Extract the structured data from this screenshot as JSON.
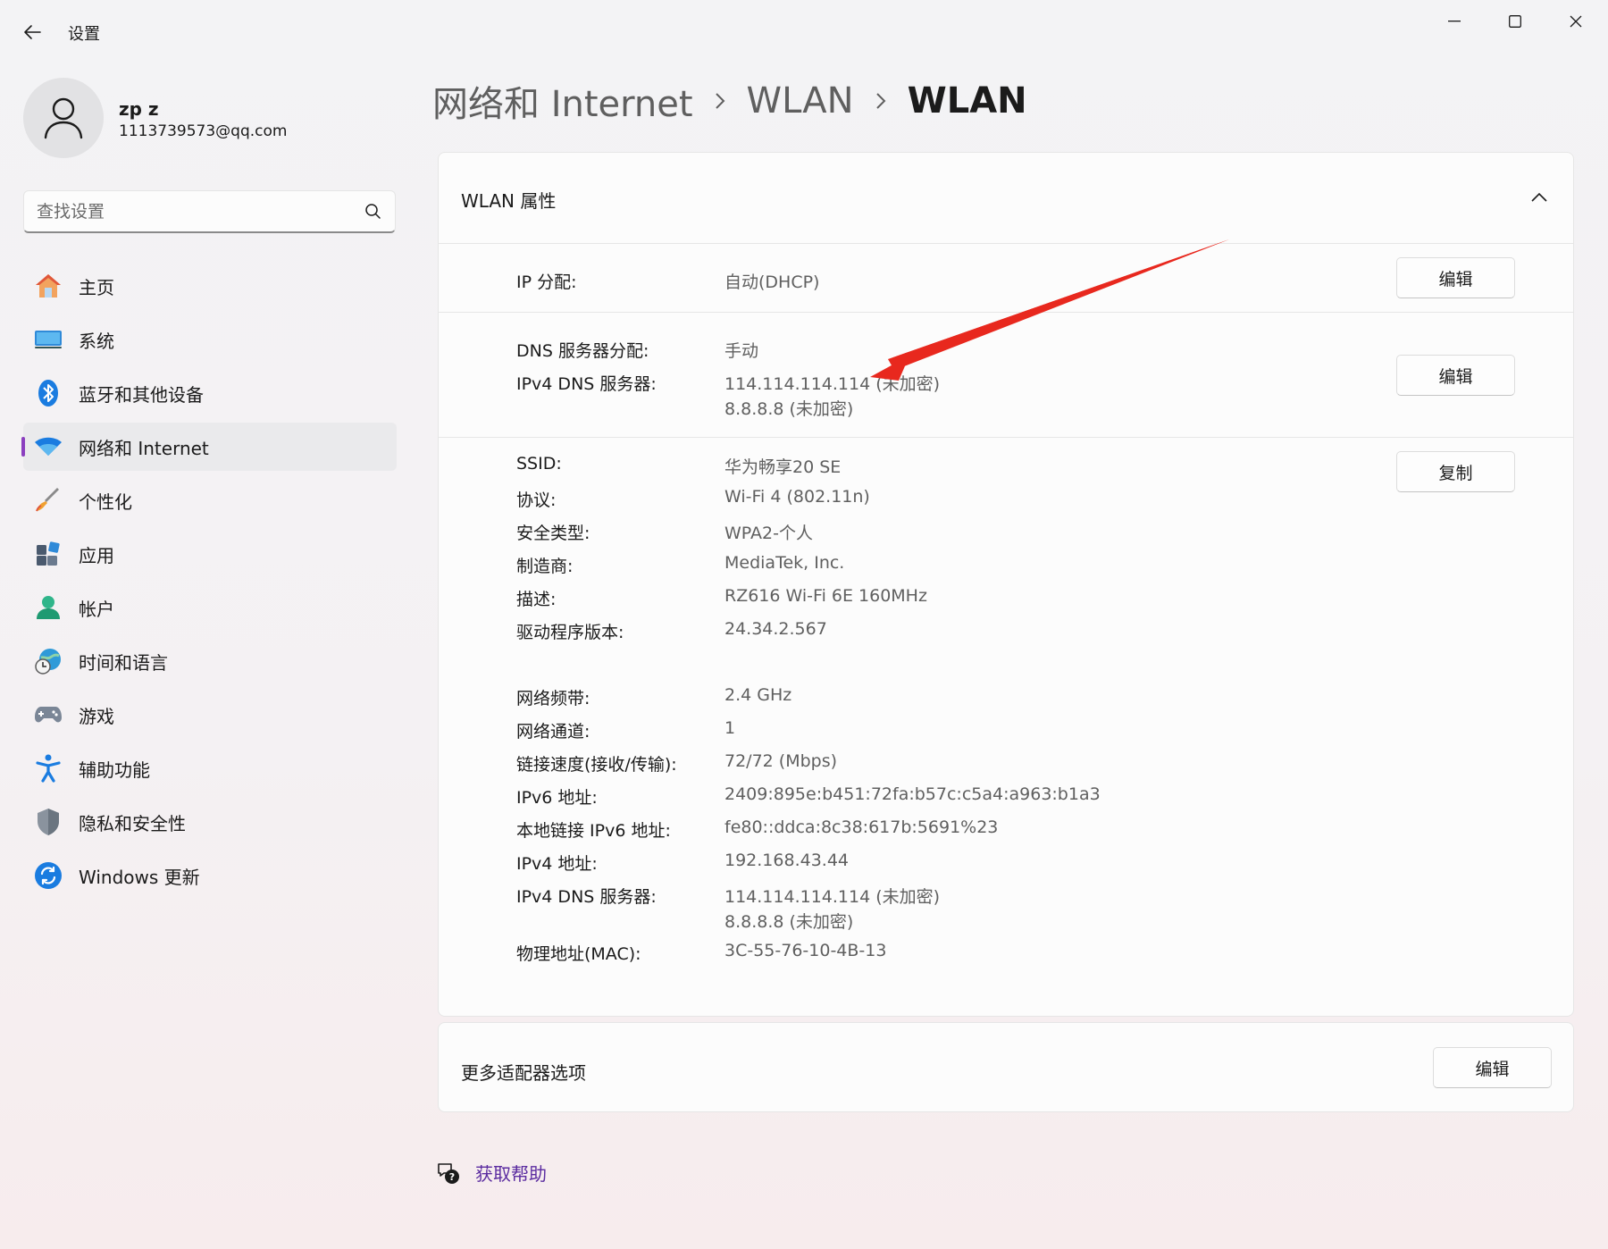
{
  "window": {
    "title": "设置"
  },
  "user": {
    "name": "zp z",
    "email": "1113739573@qq.com"
  },
  "search": {
    "placeholder": "查找设置"
  },
  "sidebar": {
    "items": [
      {
        "label": "主页",
        "icon": "home-icon"
      },
      {
        "label": "系统",
        "icon": "monitor-icon"
      },
      {
        "label": "蓝牙和其他设备",
        "icon": "bluetooth-icon"
      },
      {
        "label": "网络和 Internet",
        "icon": "wifi-icon",
        "active": true
      },
      {
        "label": "个性化",
        "icon": "brush-icon"
      },
      {
        "label": "应用",
        "icon": "apps-icon"
      },
      {
        "label": "帐户",
        "icon": "account-icon"
      },
      {
        "label": "时间和语言",
        "icon": "globe-clock-icon"
      },
      {
        "label": "游戏",
        "icon": "gamepad-icon"
      },
      {
        "label": "辅助功能",
        "icon": "accessibility-icon"
      },
      {
        "label": "隐私和安全性",
        "icon": "shield-icon"
      },
      {
        "label": "Windows 更新",
        "icon": "update-icon"
      }
    ]
  },
  "breadcrumb": [
    "网络和 Internet",
    "WLAN",
    "WLAN"
  ],
  "properties": {
    "title": "WLAN 属性",
    "ip": {
      "label": "IP 分配:",
      "value": "自动(DHCP)",
      "button": "编辑"
    },
    "dns": {
      "assign_label": "DNS 服务器分配:",
      "assign_value": "手动",
      "ipv4_label": "IPv4 DNS 服务器:",
      "ipv4_value_1": "114.114.114.114 (未加密)",
      "ipv4_value_2": "8.8.8.8 (未加密)",
      "button": "编辑"
    },
    "details_button": "复制",
    "details": [
      {
        "label": "SSID:",
        "value": "华为畅享20 SE"
      },
      {
        "label": "协议:",
        "value": "Wi-Fi 4 (802.11n)"
      },
      {
        "label": "安全类型:",
        "value": "WPA2-个人"
      },
      {
        "label": "制造商:",
        "value": "MediaTek, Inc."
      },
      {
        "label": "描述:",
        "value": "RZ616 Wi-Fi 6E 160MHz"
      },
      {
        "label": "驱动程序版本:",
        "value": "24.34.2.567"
      },
      {
        "label": "网络频带:",
        "value": "2.4 GHz"
      },
      {
        "label": "网络通道:",
        "value": "1"
      },
      {
        "label": "链接速度(接收/传输):",
        "value": "72/72 (Mbps)"
      },
      {
        "label": "IPv6 地址:",
        "value": "2409:895e:b451:72fa:b57c:c5a4:a963:b1a3"
      },
      {
        "label": "本地链接 IPv6 地址:",
        "value": "fe80::ddca:8c38:617b:5691%23"
      },
      {
        "label": "IPv4 地址:",
        "value": "192.168.43.44"
      },
      {
        "label": "IPv4 DNS 服务器:",
        "value": "114.114.114.114 (未加密)",
        "value2": "8.8.8.8 (未加密)"
      },
      {
        "label": "物理地址(MAC):",
        "value": "3C-55-76-10-4B-13"
      }
    ]
  },
  "more_adapter": {
    "label": "更多适配器选项",
    "button": "编辑"
  },
  "help": {
    "label": "获取帮助"
  },
  "colors": {
    "accent": "#8b3fbf",
    "annotation_arrow": "#e8281e",
    "link": "#5b2ca0"
  }
}
